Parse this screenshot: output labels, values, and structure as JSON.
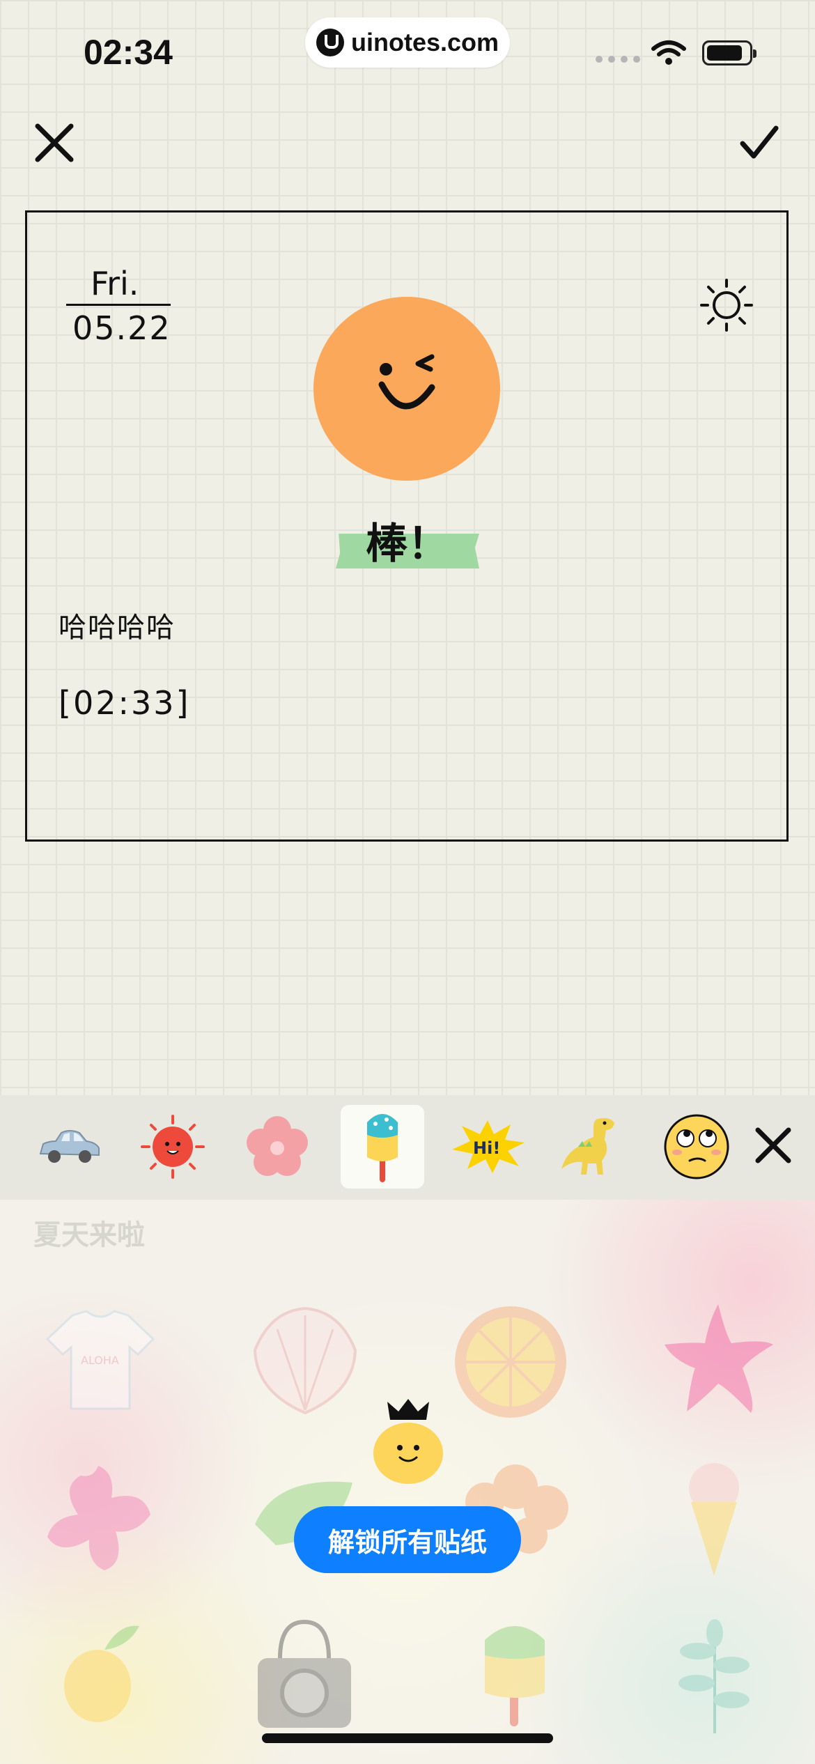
{
  "status_bar": {
    "time": "02:34",
    "url": "uinotes.com"
  },
  "top_actions": {
    "close_icon": "close-icon",
    "confirm_icon": "checkmark-icon"
  },
  "entry": {
    "day": "Fri.",
    "date": "05.22",
    "weather_icon": "sun-icon",
    "mood_icon": "winking-face-icon",
    "mood_label": "棒！",
    "text": "哈哈哈哈",
    "timestamp": "[02:33]"
  },
  "sticker_bar": {
    "tabs": [
      {
        "icon": "car-icon"
      },
      {
        "icon": "sun-face-icon"
      },
      {
        "icon": "flower-icon"
      },
      {
        "icon": "popsicle-icon",
        "active": true
      },
      {
        "icon": "hi-burst-icon"
      },
      {
        "icon": "dinosaur-icon"
      },
      {
        "icon": "eye-roll-face-icon"
      }
    ],
    "close_icon": "close-icon"
  },
  "sticker_panel": {
    "category_title": "夏天来啦",
    "unlock_label": "解锁所有贴纸",
    "stickers": [
      "aloha-shirt",
      "shell",
      "lemon-slice",
      "starfish",
      "pink-flower",
      "leaf",
      "hibiscus",
      "ice-cream-cone",
      "lemon",
      "camera",
      "popsicle",
      "plant"
    ]
  },
  "colors": {
    "accent_blue": "#0d7fff",
    "mood_orange": "#fca85b",
    "tape_green": "#9fd8a0"
  }
}
